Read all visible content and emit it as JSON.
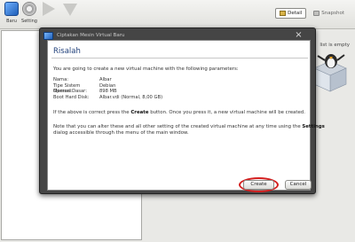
{
  "toolbar": {
    "new_label": "Baru",
    "settings_label": "Setting"
  },
  "tabs": {
    "details_label": "Detail",
    "snapshot_label": "Snapshot"
  },
  "right_panel": {
    "hint": "list is empty"
  },
  "dialog": {
    "title": "Ciptakan Mesin Virtual Baru",
    "heading": "Risalah",
    "intro": "You are going to create a new virtual machine with the following parameters:",
    "params": [
      {
        "key": "Nama:",
        "value": "Albar"
      },
      {
        "key": "Tipe Sistem Operasi:",
        "value": "Debian"
      },
      {
        "key": "Memori Dasar:",
        "value": "898 MB"
      },
      {
        "key": "Boot Hard Disk:",
        "value": "Albar.vdi (Normal, 8,00 GB)"
      }
    ],
    "confirm_pre": "If the above is correct press the ",
    "confirm_strong": "Create",
    "confirm_post": " button. Once you press it, a new virtual machine will be created.",
    "note1_pre": "Note that you can alter these and all other setting of the created virtual machine at any time using the ",
    "note1_strong": "Settings",
    "note2": "dialog accessible through the menu of the main window.",
    "create_label": "Create",
    "cancel_label": "Cancel",
    "close_glyph": "×"
  },
  "colors": {
    "heading": "#1f3f7a",
    "highlight_ring": "#d42020"
  }
}
